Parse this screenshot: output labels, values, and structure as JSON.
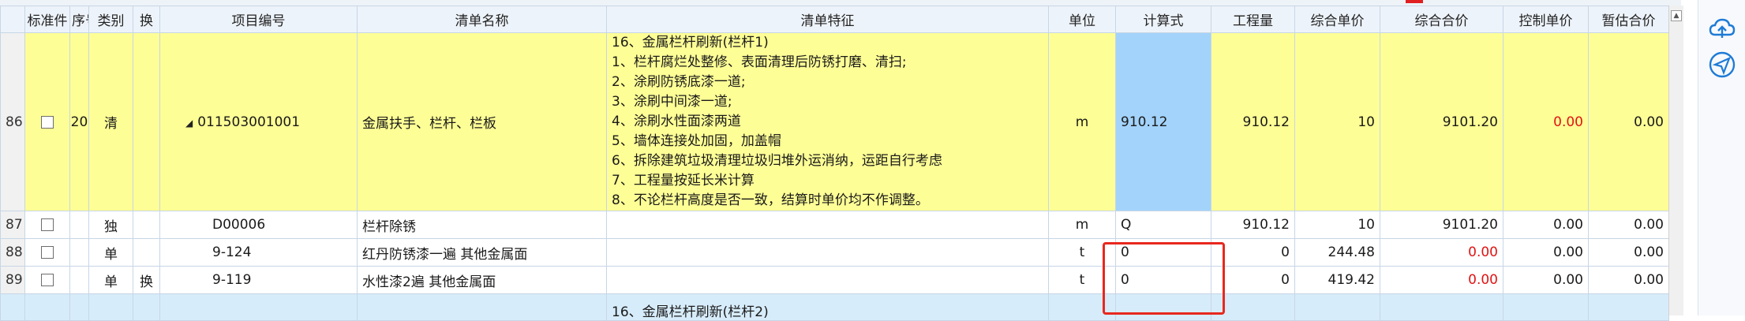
{
  "columns": [
    "",
    "标准件",
    "序号",
    "类别",
    "换",
    "项目编号",
    "清单名称",
    "清单特征",
    "单位",
    "计算式",
    "工程量",
    "综合单价",
    "综合合价",
    "控制单价",
    "暂估合价"
  ],
  "rows": [
    {
      "no": "86",
      "seq": "20",
      "type": "清",
      "swap": "",
      "code": "011503001001",
      "name": "金属扶手、栏杆、栏板",
      "features": [
        "16、金属栏杆刷新(栏杆1)",
        "1、栏杆腐烂处整修、表面清理后防锈打磨、清扫;",
        "2、涂刷防锈底漆一道;",
        "3、涂刷中间漆一道;",
        "4、涂刷水性面漆两道",
        "5、墙体连接处加固，加盖帽",
        "6、拆除建筑垃圾清理垃圾归堆外运消纳，运距自行考虑",
        "7、工程量按延长米计算",
        "8、不论栏杆高度是否一致，结算时单价均不作调整。"
      ],
      "unit": "m",
      "formula": "910.12",
      "qty": "910.12",
      "price": "10",
      "total": "9101.20",
      "ctrl": "0.00",
      "est": "0.00"
    },
    {
      "no": "87",
      "seq": "",
      "type": "独",
      "swap": "",
      "code": "D00006",
      "name": "栏杆除锈",
      "unit": "m",
      "formula": "Q",
      "qty": "910.12",
      "price": "10",
      "total": "9101.20",
      "ctrl": "0.00",
      "est": "0.00"
    },
    {
      "no": "88",
      "seq": "",
      "type": "单",
      "swap": "",
      "code": "9-124",
      "name": "红丹防锈漆一遍 其他金属面",
      "unit": "t",
      "formula": "0",
      "qty": "0",
      "price": "244.48",
      "total": "0.00",
      "ctrl": "0.00",
      "est": "0.00"
    },
    {
      "no": "89",
      "seq": "",
      "type": "单",
      "swap": "换",
      "code": "9-119",
      "name": "水性漆2遍 其他金属面",
      "unit": "t",
      "formula": "0",
      "qty": "0",
      "price": "419.42",
      "total": "0.00",
      "ctrl": "0.00",
      "est": "0.00"
    }
  ],
  "partial_row": {
    "feature": "16、金属栏杆刷新(栏杆2)"
  },
  "colors": {
    "yellow_row": "#fefe96",
    "formula_cell": "#a3d3fb",
    "header_bg": "#edf3fa",
    "negative_red": "#e01414",
    "highlight_box": "#e8281e",
    "next_row": "#d7ecfa"
  },
  "side_icons": [
    "cloud-icon",
    "send-icon"
  ]
}
